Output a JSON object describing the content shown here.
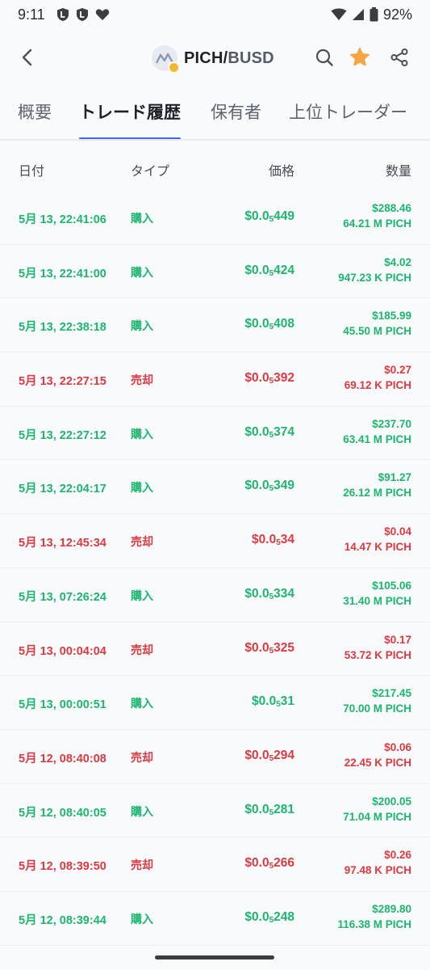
{
  "status_bar": {
    "time": "9:11",
    "battery": "92%"
  },
  "header": {
    "base": "PICH",
    "separator": "/",
    "quote": "BUSD"
  },
  "tabs": [
    {
      "label": "概要",
      "active": false
    },
    {
      "label": "トレード履歴",
      "active": true
    },
    {
      "label": "保有者",
      "active": false
    },
    {
      "label": "上位トレーダー",
      "active": false
    }
  ],
  "columns": {
    "date": "日付",
    "type": "タイプ",
    "price": "価格",
    "quantity": "数量"
  },
  "colors": {
    "buy": "#1db66f",
    "sell": "#dc3a41",
    "accent": "#3b6ee8",
    "favorite": "#f5a541"
  },
  "trades": [
    {
      "date": "5月 13, 22:41:06",
      "side": "buy",
      "type": "購入",
      "price_prefix": "$0.0",
      "price_zeros": "5",
      "price_digits": "449",
      "amount": "$288.46",
      "qty": "64.21 M PICH"
    },
    {
      "date": "5月 13, 22:41:00",
      "side": "buy",
      "type": "購入",
      "price_prefix": "$0.0",
      "price_zeros": "5",
      "price_digits": "424",
      "amount": "$4.02",
      "qty": "947.23 K PICH"
    },
    {
      "date": "5月 13, 22:38:18",
      "side": "buy",
      "type": "購入",
      "price_prefix": "$0.0",
      "price_zeros": "5",
      "price_digits": "408",
      "amount": "$185.99",
      "qty": "45.50 M PICH"
    },
    {
      "date": "5月 13, 22:27:15",
      "side": "sell",
      "type": "売却",
      "price_prefix": "$0.0",
      "price_zeros": "5",
      "price_digits": "392",
      "amount": "$0.27",
      "qty": "69.12 K PICH"
    },
    {
      "date": "5月 13, 22:27:12",
      "side": "buy",
      "type": "購入",
      "price_prefix": "$0.0",
      "price_zeros": "5",
      "price_digits": "374",
      "amount": "$237.70",
      "qty": "63.41 M PICH"
    },
    {
      "date": "5月 13, 22:04:17",
      "side": "buy",
      "type": "購入",
      "price_prefix": "$0.0",
      "price_zeros": "5",
      "price_digits": "349",
      "amount": "$91.27",
      "qty": "26.12 M PICH"
    },
    {
      "date": "5月 13, 12:45:34",
      "side": "sell",
      "type": "売却",
      "price_prefix": "$0.0",
      "price_zeros": "5",
      "price_digits": "34",
      "amount": "$0.04",
      "qty": "14.47 K PICH"
    },
    {
      "date": "5月 13, 07:26:24",
      "side": "buy",
      "type": "購入",
      "price_prefix": "$0.0",
      "price_zeros": "5",
      "price_digits": "334",
      "amount": "$105.06",
      "qty": "31.40 M PICH"
    },
    {
      "date": "5月 13, 00:04:04",
      "side": "sell",
      "type": "売却",
      "price_prefix": "$0.0",
      "price_zeros": "5",
      "price_digits": "325",
      "amount": "$0.17",
      "qty": "53.72 K PICH"
    },
    {
      "date": "5月 13, 00:00:51",
      "side": "buy",
      "type": "購入",
      "price_prefix": "$0.0",
      "price_zeros": "5",
      "price_digits": "31",
      "amount": "$217.45",
      "qty": "70.00 M PICH"
    },
    {
      "date": "5月 12, 08:40:08",
      "side": "sell",
      "type": "売却",
      "price_prefix": "$0.0",
      "price_zeros": "5",
      "price_digits": "294",
      "amount": "$0.06",
      "qty": "22.45 K PICH"
    },
    {
      "date": "5月 12, 08:40:05",
      "side": "buy",
      "type": "購入",
      "price_prefix": "$0.0",
      "price_zeros": "5",
      "price_digits": "281",
      "amount": "$200.05",
      "qty": "71.04 M PICH"
    },
    {
      "date": "5月 12, 08:39:50",
      "side": "sell",
      "type": "売却",
      "price_prefix": "$0.0",
      "price_zeros": "5",
      "price_digits": "266",
      "amount": "$0.26",
      "qty": "97.48 K PICH"
    },
    {
      "date": "5月 12, 08:39:44",
      "side": "buy",
      "type": "購入",
      "price_prefix": "$0.0",
      "price_zeros": "5",
      "price_digits": "248",
      "amount": "$289.80",
      "qty": "116.38 M PICH"
    }
  ]
}
